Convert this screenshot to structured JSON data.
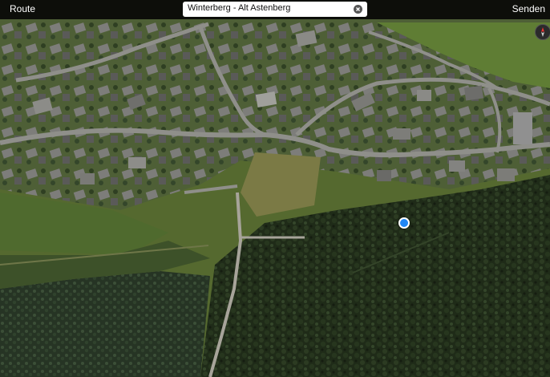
{
  "toolbar": {
    "route_label": "Route",
    "send_label": "Senden"
  },
  "search": {
    "value": "Winterberg - Alt Astenberg"
  },
  "map": {
    "type": "satellite",
    "icons": [
      "clear-icon",
      "compass-icon",
      "current-location-dot"
    ],
    "colors": {
      "location_dot": "#1f87f5",
      "forest": "#1e2a17",
      "meadow": "#4f6a2e",
      "road": "#8f8f8a"
    }
  }
}
